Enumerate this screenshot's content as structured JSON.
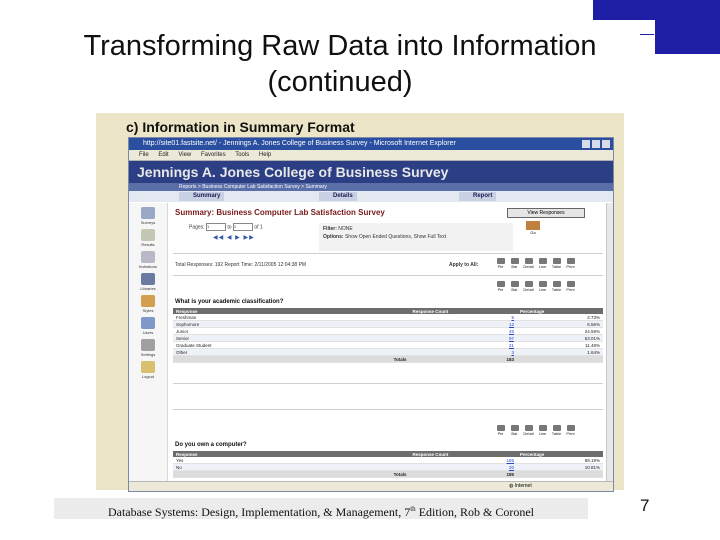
{
  "slide": {
    "title_line1": "Transforming Raw Data into Information",
    "title_line2": "(continued)",
    "footer_pre": "Database Systems: Design, Implementation, & Management, 7",
    "footer_sup": "th",
    "footer_post": " Edition, Rob & Coronel",
    "page_number": "7",
    "accent_color": "#1f1fa6"
  },
  "screenshot": {
    "heading": "c) Information in Summary Format",
    "window_title": "http://site01.fastsite.net/ - Jennings A. Jones College of Business Survey - Microsoft Internet Explorer",
    "menu": [
      "File",
      "Edit",
      "View",
      "Favorites",
      "Tools",
      "Help"
    ],
    "banner": "Jennings A. Jones College of Business Survey",
    "breadcrumb": "Reports > Business Computer Lab Satisfaction Survey > Summary",
    "tabs": [
      "Summary",
      "Details",
      "Report"
    ],
    "sidebar": [
      "Surveys",
      "Results",
      "Invitations",
      "Libraries",
      "Styles",
      "Users",
      "Settings",
      "Logout"
    ],
    "summary_title": "Summary: Business Computer Lab Satisfaction Survey",
    "view_responses": "View Responses",
    "pages_label": "Pages:",
    "page_from": "1",
    "page_to_label": "to",
    "page_to": "1",
    "page_of": "of 1",
    "filter_label": "Filter:",
    "filter_value": "NONE",
    "options_label": "Options:",
    "options_value": "Show Open Ended Questions, Show Full Text",
    "go_label": "Go",
    "responses_line": "Total Responses: 192   Report Time: 2/11/2005 12:04:38 PM",
    "apply_all": "Apply to All:",
    "icon_labels": [
      "Pie",
      "Bar",
      "Detail",
      "Line",
      "Table",
      "Print"
    ],
    "q1": {
      "question": "What is your academic classification?",
      "col_response": "Response",
      "col_count": "Response Count",
      "col_pct": "Percentage",
      "rows": [
        {
          "label": "Freshman",
          "count": "5",
          "pct": "2.73%"
        },
        {
          "label": "Sophomore",
          "count": "12",
          "pct": "6.56%"
        },
        {
          "label": "Junior",
          "count": "45",
          "pct": "24.59%"
        },
        {
          "label": "Senior",
          "count": "97",
          "pct": "53.01%"
        },
        {
          "label": "Graduate Student",
          "count": "21",
          "pct": "11.48%"
        },
        {
          "label": "Other",
          "count": "3",
          "pct": "1.64%"
        }
      ],
      "totals_label": "Totals",
      "totals_value": "183"
    },
    "q2": {
      "question": "Do you own a computer?",
      "col_response": "Response",
      "col_count": "Response Count",
      "col_pct": "Percentage",
      "rows": [
        {
          "label": "Yes",
          "count": "165",
          "pct": "89.19%"
        },
        {
          "label": "No",
          "count": "20",
          "pct": "10.81%"
        }
      ],
      "totals_label": "Totals",
      "totals_value": "185"
    },
    "status_zone": "Internet"
  }
}
